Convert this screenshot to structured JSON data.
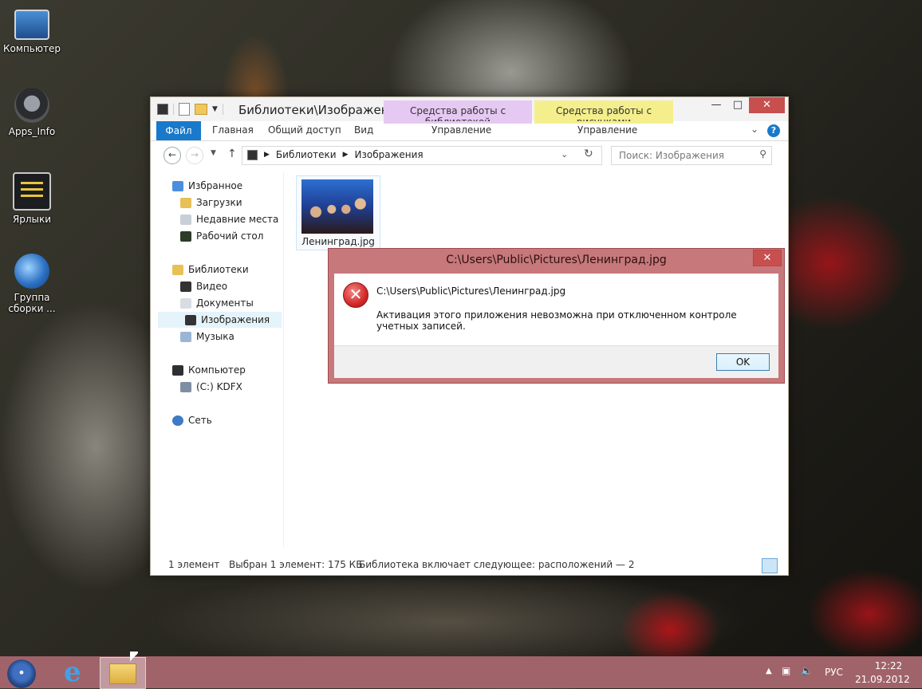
{
  "desktop": {
    "icons": [
      {
        "label": "Компьютер",
        "icon": "computer-icon"
      },
      {
        "label": "Apps_Info",
        "icon": "apps-info-icon"
      },
      {
        "label": "Ярлыки",
        "icon": "shortcuts-icon"
      },
      {
        "label": "Группа сборки ...",
        "icon": "globe-shortcut-icon"
      }
    ]
  },
  "explorer": {
    "title": "Библиотеки\\Изображен...",
    "context_tabs": {
      "library_tools": "Средства работы с библиотекой",
      "picture_tools": "Средства работы с рисунками"
    },
    "ribbon_tabs": {
      "file": "Файл",
      "home": "Главная",
      "share": "Общий доступ",
      "view": "Вид",
      "manage1": "Управление",
      "manage2": "Управление"
    },
    "window_buttons": {
      "minimize": "—",
      "maximize": "□",
      "close": "✕"
    },
    "address": {
      "crumb1": "Библиотеки",
      "crumb2": "Изображения"
    },
    "search_placeholder": "Поиск: Изображения",
    "nav": {
      "favorites": "Избранное",
      "downloads": "Загрузки",
      "recent": "Недавние места",
      "desktop": "Рабочий стол",
      "libraries": "Библиотеки",
      "video": "Видео",
      "documents": "Документы",
      "pictures": "Изображения",
      "music": "Музыка",
      "computer": "Компьютер",
      "drive_c": "(C:) KDFX",
      "network": "Сеть"
    },
    "file": {
      "name": "Ленинград.jpg"
    },
    "status": {
      "count": "1 элемент",
      "selected": "Выбран 1 элемент: 175 КБ",
      "library_info": "Библиотека включает следующее: расположений — 2"
    }
  },
  "dialog": {
    "title": "C:\\Users\\Public\\Pictures\\Ленинград.jpg",
    "path": "C:\\Users\\Public\\Pictures\\Ленинград.jpg",
    "message": "Активация этого приложения невозможна при отключенном контроле учетных записей.",
    "ok_label": "OK",
    "close": "✕"
  },
  "taskbar": {
    "lang": "РУС",
    "time": "12:22",
    "date": "21.09.2012"
  },
  "colors": {
    "accent": "#1979ca",
    "taskbar": "#a0636a",
    "dialog_frame": "#c7787a"
  }
}
